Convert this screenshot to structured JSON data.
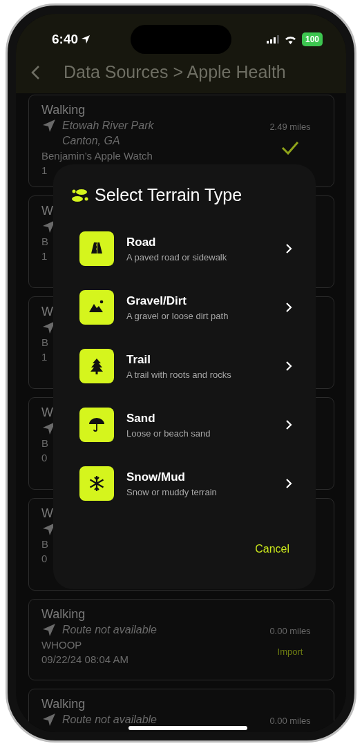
{
  "status_bar": {
    "time": "6:40",
    "battery": "100"
  },
  "header": {
    "title": "Data Sources > Apple Health"
  },
  "workouts": [
    {
      "title": "Walking",
      "location": [
        "Etowah River Park",
        "Canton, GA"
      ],
      "source": "Benjamin’s Apple Watch",
      "date": "1",
      "distance": "2.49 miles",
      "imported": true
    },
    {
      "title": "W",
      "source": "B",
      "date": "1"
    },
    {
      "title": "W",
      "source": "B",
      "date": "1"
    },
    {
      "title": "W",
      "source": "B",
      "date": "0"
    },
    {
      "title": "W",
      "source": "B",
      "date": "0"
    },
    {
      "title": "Walking",
      "location": [
        "Route not available"
      ],
      "source": "WHOOP",
      "date": "09/22/24 08:04 AM",
      "distance": "0.00 miles",
      "imported": false,
      "action": "Import"
    },
    {
      "title": "Walking",
      "location": [
        "Route not available"
      ],
      "distance": "0.00 miles"
    }
  ],
  "dialog": {
    "title": "Select Terrain Type",
    "options": [
      {
        "kind": "road",
        "name": "Road",
        "description": "A paved road or sidewalk"
      },
      {
        "kind": "mountain",
        "name": "Gravel/Dirt",
        "description": "A gravel or loose dirt path"
      },
      {
        "kind": "tree",
        "name": "Trail",
        "description": "A trail with roots and rocks"
      },
      {
        "kind": "umbrella",
        "name": "Sand",
        "description": "Loose or beach sand"
      },
      {
        "kind": "snow",
        "name": "Snow/Mud",
        "description": "Snow or muddy terrain"
      }
    ],
    "cancel": "Cancel"
  }
}
